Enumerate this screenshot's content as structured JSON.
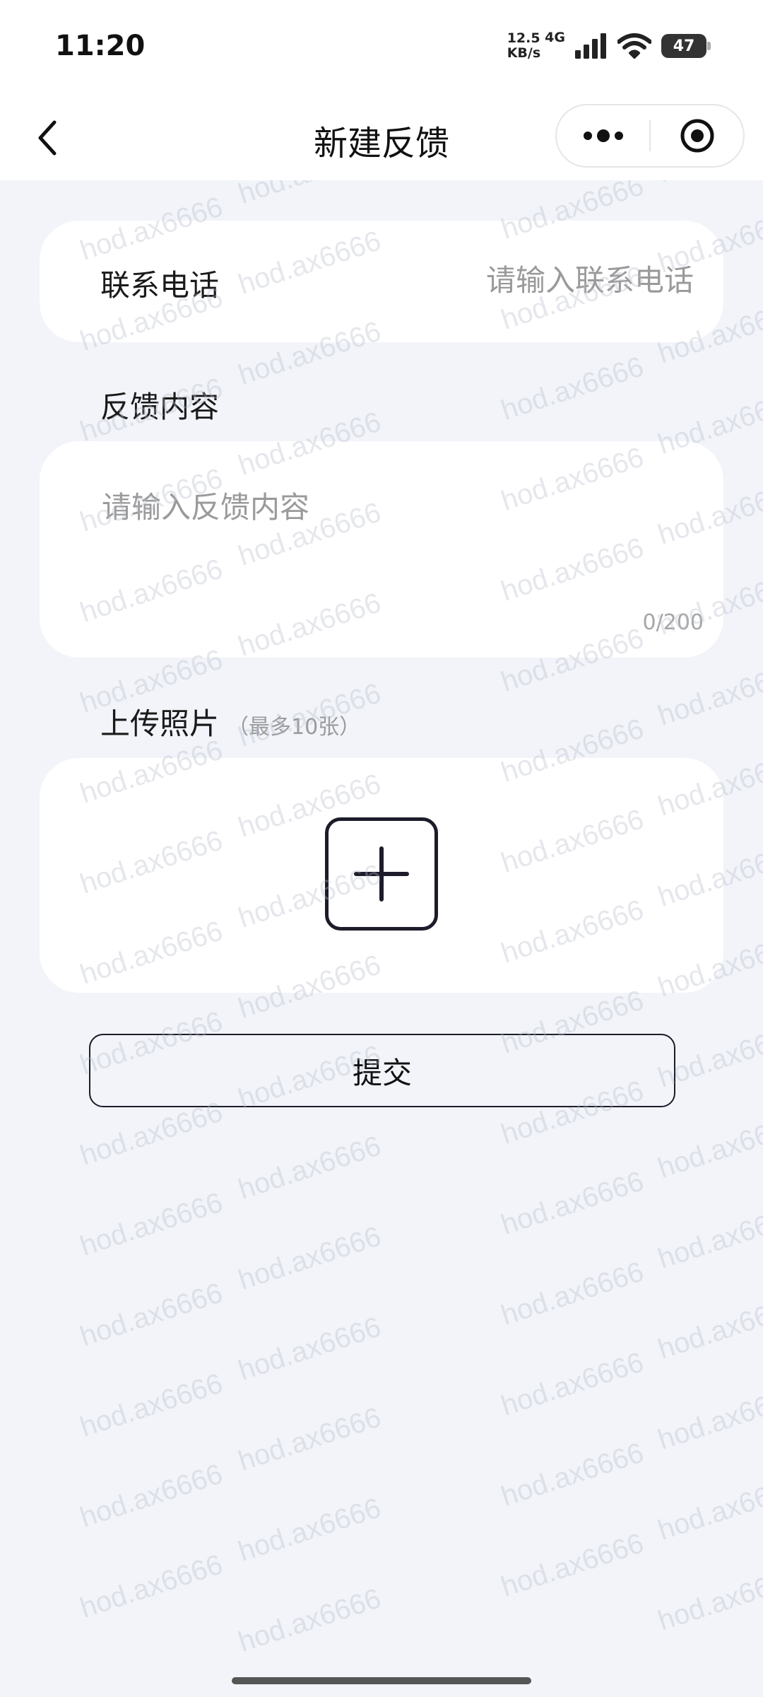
{
  "status_bar": {
    "time": "11:20",
    "net_speed_value": "12.5",
    "net_speed_unit": "KB/s",
    "network_type": "4G",
    "battery_level": "47",
    "icons": [
      "signal-icon",
      "wifi-icon",
      "battery-icon"
    ]
  },
  "nav": {
    "title": "新建反馈",
    "back_icon": "chevron-left-icon",
    "more_icon": "more-dots-icon",
    "close_icon": "target-icon"
  },
  "form": {
    "phone": {
      "label": "联系电话",
      "value": "",
      "placeholder": "请输入联系电话"
    },
    "content": {
      "label": "反馈内容",
      "value": "",
      "placeholder": "请输入反馈内容",
      "counter": "0/200"
    },
    "photos": {
      "label": "上传照片",
      "hint": "（最多10张）",
      "add_icon": "plus-icon"
    },
    "submit_label": "提交"
  },
  "watermark": {
    "text": "hod.ax6666"
  },
  "colors": {
    "background": "#f2f4f9",
    "card": "#ffffff",
    "placeholder": "#9a9a9a",
    "accent": "#1c1c2b"
  }
}
